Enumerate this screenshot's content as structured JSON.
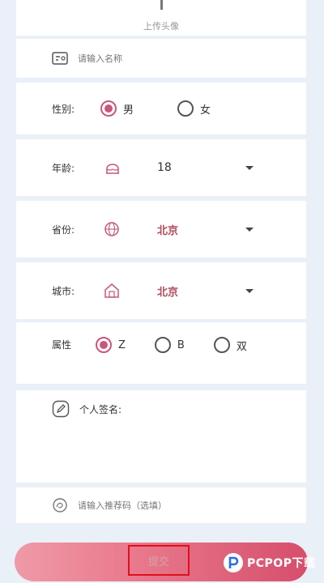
{
  "avatar": {
    "upload_label": "上传头像"
  },
  "name_field": {
    "placeholder": "请输入名称"
  },
  "gender": {
    "label": "性别:",
    "options": [
      "男",
      "女"
    ],
    "selected": "男"
  },
  "age": {
    "label": "年龄:",
    "value": "18"
  },
  "province": {
    "label": "省份:",
    "value": "北京"
  },
  "city": {
    "label": "城市:",
    "value": "北京"
  },
  "attribute": {
    "label": "属性",
    "options": [
      "Z",
      "B",
      "双"
    ],
    "selected": "Z"
  },
  "signature": {
    "label": "个人签名:"
  },
  "referral": {
    "placeholder": "请输入推荐码（选填）"
  },
  "submit": {
    "label": "提交"
  },
  "watermark": {
    "text": "PCPOP下载"
  },
  "colors": {
    "accent": "#c8577a",
    "value_red": "#b24a5c",
    "background": "#eaf0f8"
  },
  "icons": {
    "name": "id-card-icon",
    "age": "cake-icon",
    "province": "globe-icon",
    "city": "house-icon",
    "signature": "pencil-icon",
    "referral": "referral-icon",
    "dropdown": "chevron-down-icon"
  }
}
